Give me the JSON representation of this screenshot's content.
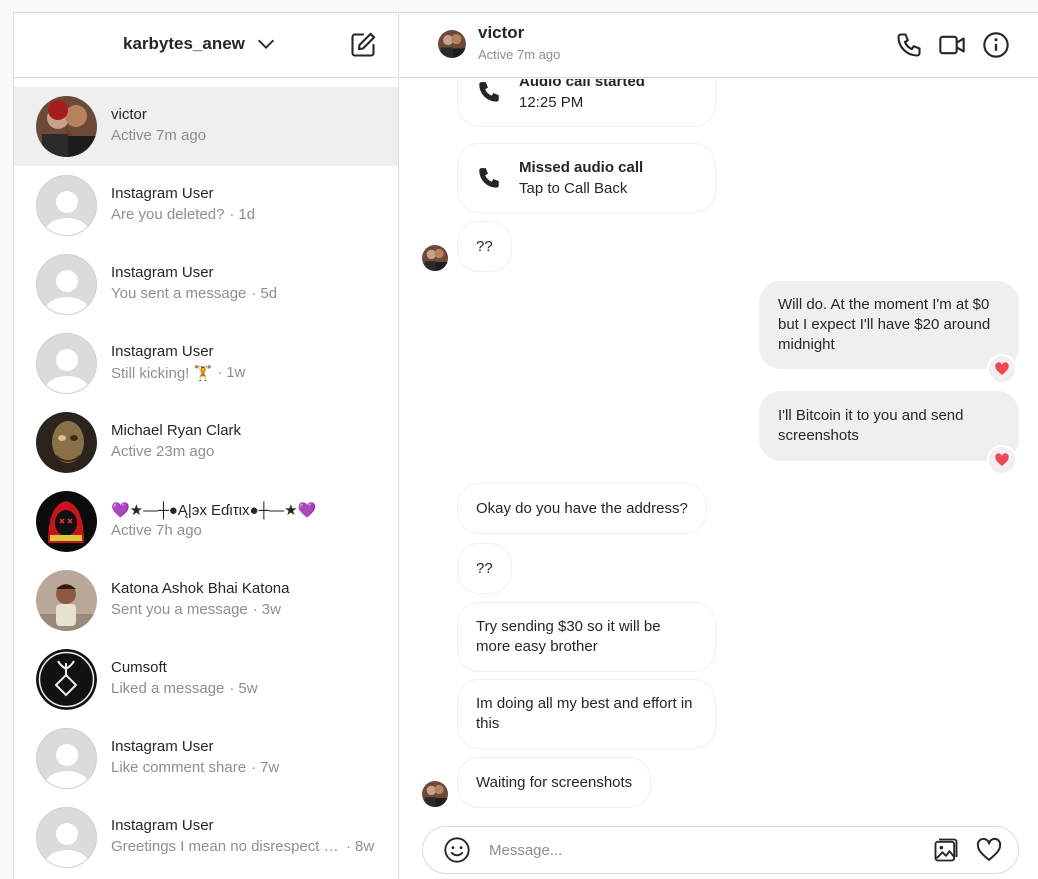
{
  "sidebar": {
    "account_name": "karbytes_anew",
    "threads": [
      {
        "name": "victor",
        "preview": "Active 7m ago",
        "time": ""
      },
      {
        "name": "Instagram User",
        "preview": "Are you deleted?",
        "time": "1d"
      },
      {
        "name": "Instagram User",
        "preview": "You sent a message",
        "time": "5d"
      },
      {
        "name": "Instagram User",
        "preview": "Still kicking! 🏋",
        "time": "1w"
      },
      {
        "name": "Michael Ryan Clark",
        "preview": "Active 23m ago",
        "time": ""
      },
      {
        "name": "💜★—┼●Ą|эx Eɗιτιx●┼—★💜",
        "preview": "Active 7h ago",
        "time": ""
      },
      {
        "name": "Katona Ashok Bhai Katona",
        "preview": "Sent you a message",
        "time": "3w"
      },
      {
        "name": "Cumsoft",
        "preview": "Liked a message",
        "time": "5w"
      },
      {
        "name": "Instagram User",
        "preview": "Like comment share",
        "time": "7w"
      },
      {
        "name": "Instagram User",
        "preview": "Greetings I mean no disrespect but I see that",
        "time": "8w"
      }
    ]
  },
  "chat": {
    "name": "victor",
    "status": "Active 7m ago",
    "calls": [
      {
        "title": "Audio call started",
        "sub": "12:25 PM"
      },
      {
        "title": "Missed audio call",
        "sub": "Tap to Call Back"
      }
    ],
    "messages": [
      {
        "text": "??"
      },
      {
        "text": "Will do. At the moment I'm at $0 but I expect I'll have $20 around midnight"
      },
      {
        "text": "I'll Bitcoin it to you and send screenshots"
      },
      {
        "text": "Okay do you have the address?"
      },
      {
        "text": "??"
      },
      {
        "text": "Try sending $30 so it will be more easy brother"
      },
      {
        "text": "Im doing all my best and effort in this"
      },
      {
        "text": "Waiting for screenshots"
      }
    ],
    "composer_placeholder": "Message..."
  },
  "colors": {
    "accent_heart": "#ed4956",
    "border": "#dbdbdb",
    "muted_text": "#8e8e8e"
  },
  "icons": [
    "chevron-down-icon",
    "compose-icon",
    "phone-icon",
    "video-icon",
    "info-icon",
    "emoji-icon",
    "image-icon",
    "heart-icon"
  ]
}
